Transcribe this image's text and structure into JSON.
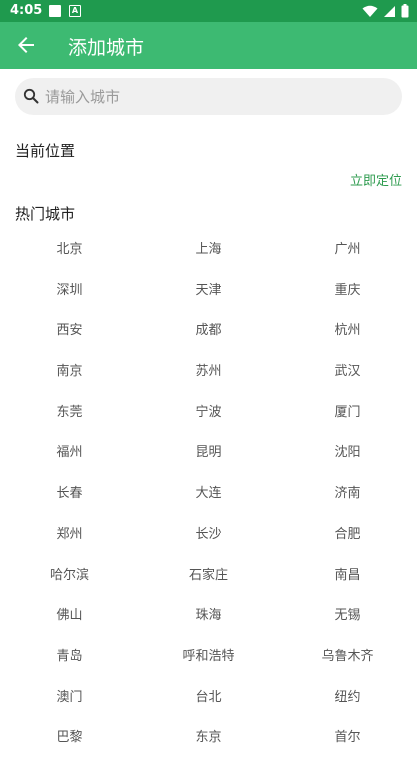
{
  "status": {
    "time": "4:05"
  },
  "header": {
    "title": "添加城市"
  },
  "search": {
    "placeholder": "请输入城市",
    "value": ""
  },
  "current_location": {
    "title": "当前位置",
    "locate_label": "立即定位"
  },
  "hot_cities": {
    "title": "热门城市",
    "items": [
      "北京",
      "上海",
      "广州",
      "深圳",
      "天津",
      "重庆",
      "西安",
      "成都",
      "杭州",
      "南京",
      "苏州",
      "武汉",
      "东莞",
      "宁波",
      "厦门",
      "福州",
      "昆明",
      "沈阳",
      "长春",
      "大连",
      "济南",
      "郑州",
      "长沙",
      "合肥",
      "哈尔滨",
      "石家庄",
      "南昌",
      "佛山",
      "珠海",
      "无锡",
      "青岛",
      "呼和浩特",
      "乌鲁木齐",
      "澳门",
      "台北",
      "纽约",
      "巴黎",
      "东京",
      "首尔"
    ]
  },
  "theme": {
    "statusbar": "#1f9a4e",
    "appbar": "#3dba72",
    "accent": "#2d9b4e"
  },
  "icons": {
    "back": "arrow-left-icon",
    "search": "search-icon"
  }
}
